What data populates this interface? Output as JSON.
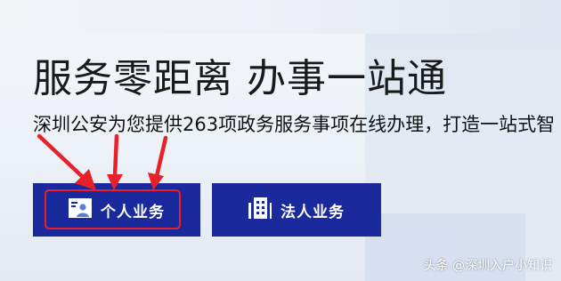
{
  "hero": {
    "headline": "服务零距离 办事一站通",
    "subtitle": "深圳公安为您提供263项政务服务事项在线办理，打造一站式智"
  },
  "buttons": {
    "personal_label": "个人业务",
    "corporate_label": "法人业务"
  },
  "icons": {
    "personal": "person-card-icon",
    "corporate": "building-icon"
  },
  "watermark": "头条 @深圳入户小知识",
  "colors": {
    "button_bg": "#1a2a9c",
    "annotation_red": "#e8202a",
    "page_bg": "#eef2f8"
  }
}
